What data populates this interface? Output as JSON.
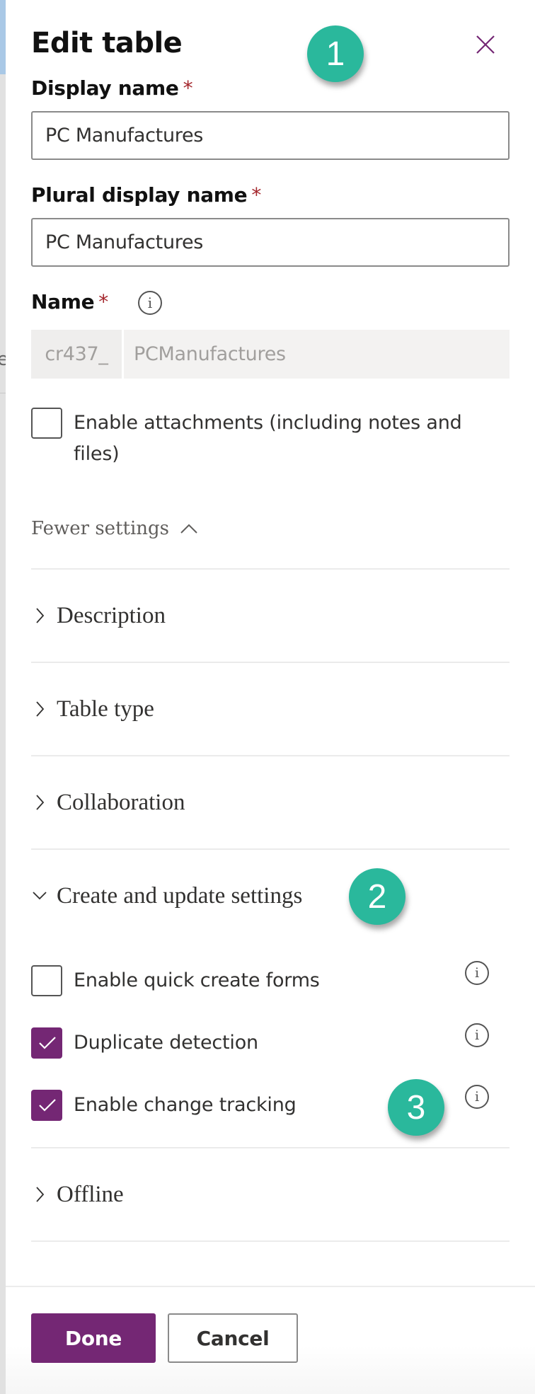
{
  "panel": {
    "title": "Edit table",
    "close_icon": "close-icon"
  },
  "fields": {
    "display_name": {
      "label": "Display name",
      "required_mark": "*",
      "value": "PC Manufactures"
    },
    "plural_display_name": {
      "label": "Plural display name",
      "required_mark": "*",
      "value": "PC Manufactures"
    },
    "name": {
      "label": "Name",
      "required_mark": "*",
      "info_icon": "i",
      "prefix": "cr437_",
      "value": "PCManufactures"
    }
  },
  "attachments": {
    "label_line1": "Enable attachments (including notes and",
    "label_line2": "files)",
    "checked": false
  },
  "fewer_settings": {
    "label": "Fewer settings",
    "icon": "chevron-up-icon"
  },
  "sections": [
    {
      "label": "Description",
      "expanded": false
    },
    {
      "label": "Table type",
      "expanded": false
    },
    {
      "label": "Collaboration",
      "expanded": false
    },
    {
      "label": "Create and update settings",
      "expanded": true
    },
    {
      "label": "Offline",
      "expanded": false
    }
  ],
  "create_update_options": [
    {
      "label": "Enable quick create forms",
      "checked": false,
      "info": "i"
    },
    {
      "label": "Duplicate detection",
      "checked": true,
      "info": "i"
    },
    {
      "label": "Enable change tracking",
      "checked": true,
      "info": "i"
    }
  ],
  "footer": {
    "done_label": "Done",
    "cancel_label": "Cancel"
  },
  "annotations": [
    "1",
    "2",
    "3"
  ],
  "colors": {
    "accent": "#742774",
    "badge": "#2ab89c",
    "required": "#a4262c"
  }
}
